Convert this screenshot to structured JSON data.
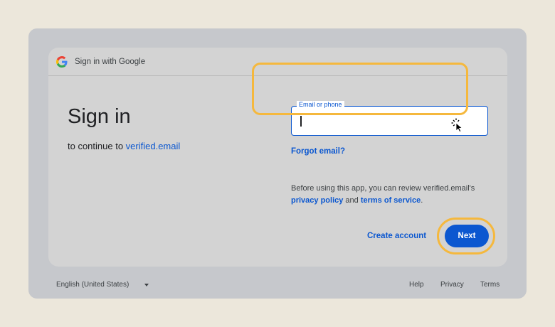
{
  "header": {
    "title": "Sign in with Google",
    "logo_icon": "google-g-icon"
  },
  "main": {
    "title": "Sign in",
    "subtitle_prefix": "to continue to ",
    "subtitle_link": "verified.email"
  },
  "form": {
    "email_label": "Email or phone",
    "email_value": "",
    "forgot_email": "Forgot email?",
    "notice_prefix": "Before using this app, you can review verified.email's ",
    "privacy_link": "privacy policy",
    "notice_and": " and ",
    "terms_link": "terms of service",
    "notice_suffix": ".",
    "create_account": "Create account",
    "next": "Next"
  },
  "footer": {
    "language": "English (United States)",
    "help": "Help",
    "privacy": "Privacy",
    "terms": "Terms"
  },
  "colors": {
    "accent": "#0b57d0",
    "highlight": "#f5b83d",
    "card": "#d3d3d3",
    "background": "#ece7db"
  }
}
